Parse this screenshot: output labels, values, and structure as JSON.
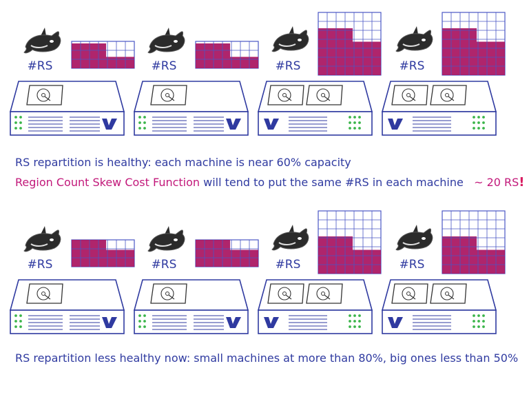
{
  "machines": [
    {
      "row": 0,
      "col": 0,
      "type": "small",
      "rs_label": "#RS",
      "load_level": 0.6
    },
    {
      "row": 0,
      "col": 1,
      "type": "small",
      "rs_label": "#RS",
      "load_level": 0.6
    },
    {
      "row": 0,
      "col": 2,
      "type": "big",
      "rs_label": "#RS",
      "load_level": 0.6
    },
    {
      "row": 0,
      "col": 3,
      "type": "big",
      "rs_label": "#RS",
      "load_level": 0.6
    },
    {
      "row": 1,
      "col": 0,
      "type": "small",
      "rs_label": "#RS",
      "load_level": 0.8
    },
    {
      "row": 1,
      "col": 1,
      "type": "small",
      "rs_label": "#RS",
      "load_level": 0.8
    },
    {
      "row": 1,
      "col": 2,
      "type": "big",
      "rs_label": "#RS",
      "load_level": 0.45
    },
    {
      "row": 1,
      "col": 3,
      "type": "big",
      "rs_label": "#RS",
      "load_level": 0.45
    }
  ],
  "captions": {
    "healthy": "RS repartition is healthy: each machine is near 60% capacity",
    "function_name": "Region Count Skew Cost Function",
    "function_rest": " will tend to put the same #RS in each machine",
    "approx": "~ 20 RS",
    "exclaim": "!",
    "less_healthy": "RS repartition less healthy now: small machines at more than 80%, big ones less than 50%"
  },
  "colors": {
    "ink": "#2f3aa0",
    "grid_line": "#4a56c4",
    "fill": "#a8125f",
    "pink_text": "#c2187a",
    "led": "#3bb54a",
    "whale": "#2b2b2b"
  },
  "icons": {
    "whale": "orca-icon",
    "disk": "hard-disk-icon",
    "logo": "vendor-logo-icon",
    "leds": "status-leds-icon"
  }
}
